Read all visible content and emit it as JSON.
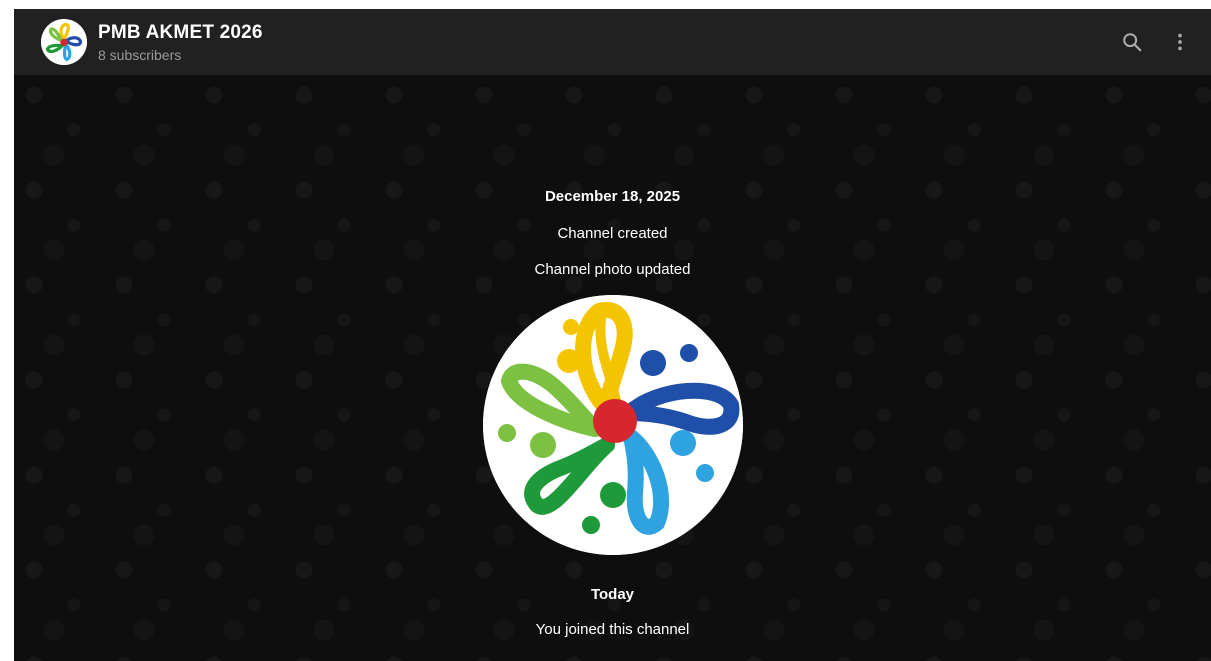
{
  "header": {
    "title": "PMB AKMET 2026",
    "subscribers": "8 subscribers",
    "search_icon": "search-icon",
    "more_icon": "more-vertical-icon"
  },
  "chat": {
    "date_1": "December 18, 2025",
    "service_created": "Channel created",
    "service_photo": "Channel photo updated",
    "date_2": "Today",
    "service_joined": "You joined this channel"
  },
  "colors": {
    "header_bg": "#212121",
    "chat_bg": "#0e0e0e",
    "logo_yellow": "#f5c400",
    "logo_blue_dark": "#1f4fa8",
    "logo_blue_light": "#2ea3e0",
    "logo_green_dark": "#1f9a3a",
    "logo_green_light": "#7cc142",
    "logo_red": "#d7262e"
  }
}
